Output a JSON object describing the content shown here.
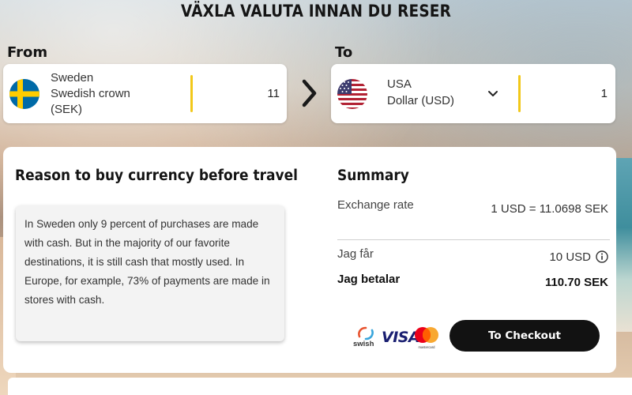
{
  "page_title": "VÄXLA VALUTA INNAN DU RESER",
  "from": {
    "label": "From",
    "country": "Sweden",
    "currency_line1": "Swedish crown",
    "currency_line2": "(SEK)",
    "amount": "11",
    "flag_icon": "sweden-flag-icon"
  },
  "to": {
    "label": "To",
    "country": "USA",
    "currency": "Dollar (USD)",
    "amount": "1",
    "flag_icon": "usa-flag-icon"
  },
  "reason": {
    "title": "Reason to buy currency before travel",
    "text": "In Sweden only 9 percent of purchases are made with cash. But in the majority of our favorite destinations, it is still cash that mostly used. In Europe, for example, 73% of payments are made in stores with cash."
  },
  "summary": {
    "title": "Summary",
    "exchange_rate_label": "Exchange rate",
    "exchange_rate_value": "1 USD = 11.0698 SEK",
    "receive_label": "Jag får",
    "receive_value": "10 USD",
    "pay_label": "Jag betalar",
    "pay_value": "110.70 SEK"
  },
  "payment": {
    "swish_label": "swish",
    "visa_label": "VISA",
    "mastercard_label": "mastercard",
    "checkout_label": "To Checkout"
  },
  "colors": {
    "accent_divider": "#f2c81a",
    "button_bg": "#121212",
    "visa_blue": "#1a1f71"
  }
}
